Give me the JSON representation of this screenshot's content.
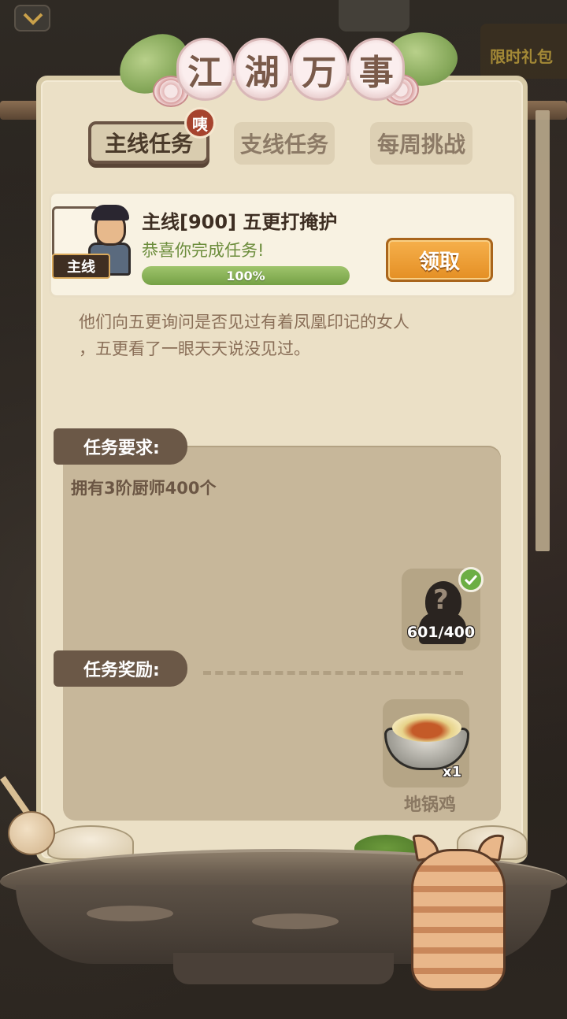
{
  "title": {
    "chars": [
      "江",
      "湖",
      "万",
      "事"
    ]
  },
  "background": {
    "gift_label": "限时礼包"
  },
  "tabs": [
    {
      "label": "主线任务",
      "active": true
    },
    {
      "label": "支线任务",
      "active": false
    },
    {
      "label": "每周挑战",
      "active": false
    }
  ],
  "tab_badge": "咦",
  "quest": {
    "tag": "主线",
    "title": "主线[900] 五更打掩护",
    "status": "恭喜你完成任务!",
    "progress_text": "100%",
    "progress_value": 1.0,
    "claim_label": "领取"
  },
  "description": {
    "line1": "他们向五更询问是否见过有着凤凰印记的女人",
    "line2": "，五更看了一眼天天说没见过。"
  },
  "requirement": {
    "header": "任务要求:",
    "text": "拥有3阶厨师400个",
    "item_count": "601/400",
    "completed": true
  },
  "reward": {
    "header": "任务奖励:",
    "item_name": "地锅鸡",
    "item_count": "x1"
  },
  "colors": {
    "panel": "#ebe0c6",
    "section_header": "#6b5847",
    "claim_button": "#e48f24",
    "progress": "#75a145",
    "status_text": "#6c8d3c",
    "badge": "#a6432e"
  }
}
